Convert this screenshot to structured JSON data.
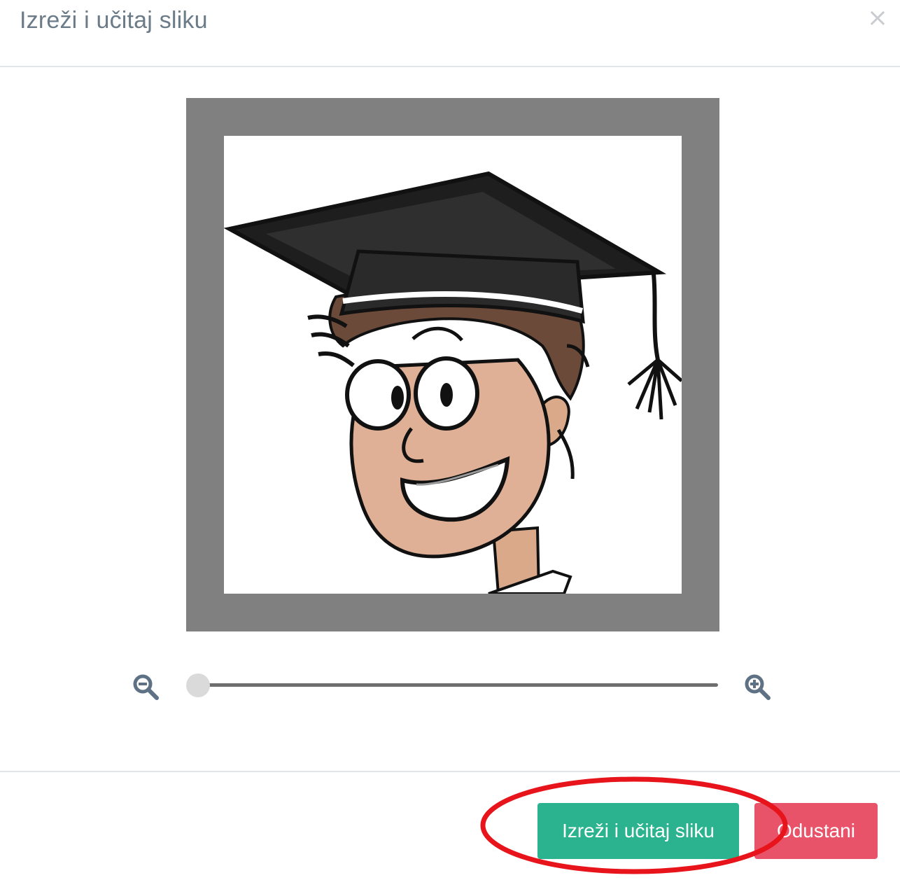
{
  "modal": {
    "title": "Izreži i učitaj sliku",
    "close_label": "×"
  },
  "cropper": {
    "zoom_level": 0,
    "image_description_icon": "cartoon-graduate-avatar"
  },
  "footer": {
    "crop_button_label": "Izreži i učitaj sliku",
    "cancel_button_label": "Odustani"
  },
  "colors": {
    "crop_button": "#2bb38f",
    "cancel_button": "#e8536a",
    "crop_frame": "#808080",
    "annotation": "#e8141c"
  }
}
